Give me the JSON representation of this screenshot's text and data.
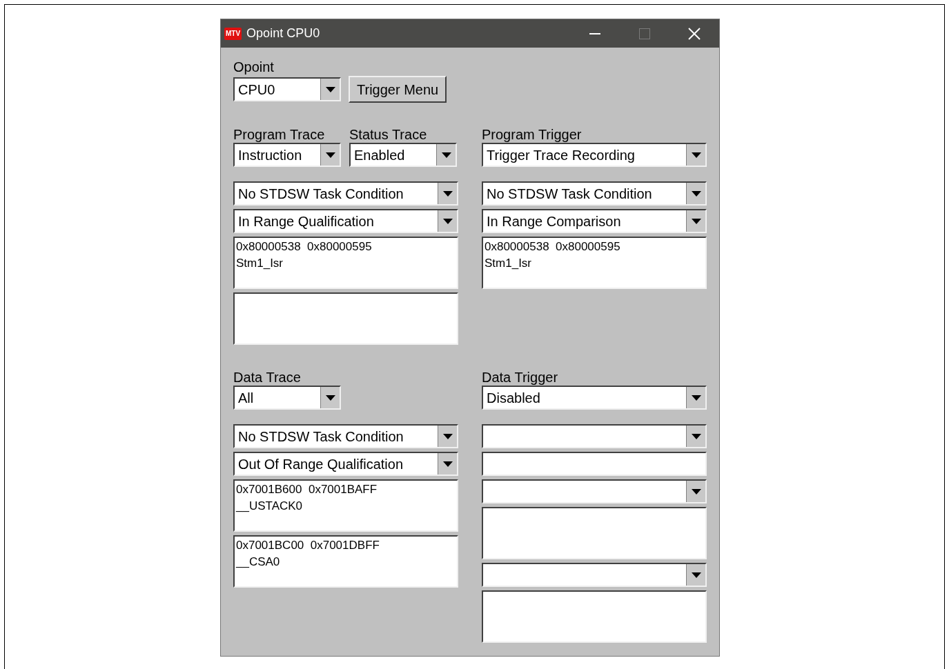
{
  "window": {
    "title": "Opoint CPU0",
    "icon_text": "MTV"
  },
  "opoint": {
    "label": "Opoint",
    "dropdown": {
      "kind": "dropdown",
      "value": "CPU0"
    },
    "button": "Trigger Menu"
  },
  "program_trace": {
    "label": "Program Trace",
    "dropdown": {
      "kind": "dropdown",
      "value": "Instruction"
    }
  },
  "status_trace": {
    "label": "Status Trace",
    "dropdown": {
      "kind": "dropdown",
      "value": "Enabled"
    }
  },
  "program_trace_controls": [
    {
      "kind": "dropdown",
      "value": "No STDSW Task Condition"
    },
    {
      "kind": "dropdown",
      "value": "In Range Qualification"
    },
    {
      "kind": "list",
      "lines": [
        "0x80000538  0x80000595",
        "Stm1_Isr"
      ]
    },
    {
      "kind": "list"
    }
  ],
  "program_trigger": {
    "label": "Program Trigger",
    "dropdown": {
      "kind": "dropdown",
      "value": "Trigger Trace Recording"
    },
    "controls": [
      {
        "kind": "dropdown",
        "value": "No STDSW Task Condition"
      },
      {
        "kind": "dropdown",
        "value": "In Range Comparison"
      },
      {
        "kind": "list",
        "lines": [
          "0x80000538  0x80000595",
          "Stm1_Isr"
        ]
      }
    ]
  },
  "data_trace": {
    "label": "Data Trace",
    "dropdown": {
      "kind": "dropdown",
      "value": "All"
    },
    "controls": [
      {
        "kind": "dropdown",
        "value": "No STDSW Task Condition"
      },
      {
        "kind": "dropdown",
        "value": "Out Of Range Qualification"
      },
      {
        "kind": "list",
        "lines": [
          "0x7001B600  0x7001BAFF",
          "__USTACK0"
        ]
      },
      {
        "kind": "list",
        "lines": [
          "0x7001BC00  0x7001DBFF",
          "__CSA0"
        ]
      }
    ]
  },
  "data_trigger": {
    "label": "Data Trigger",
    "dropdown": {
      "kind": "dropdown",
      "value": "Disabled"
    },
    "controls": [
      {
        "kind": "dropdown"
      },
      {
        "kind": "field"
      },
      {
        "kind": "dropdown"
      },
      {
        "kind": "list"
      },
      {
        "kind": "dropdown"
      },
      {
        "kind": "list"
      }
    ]
  }
}
